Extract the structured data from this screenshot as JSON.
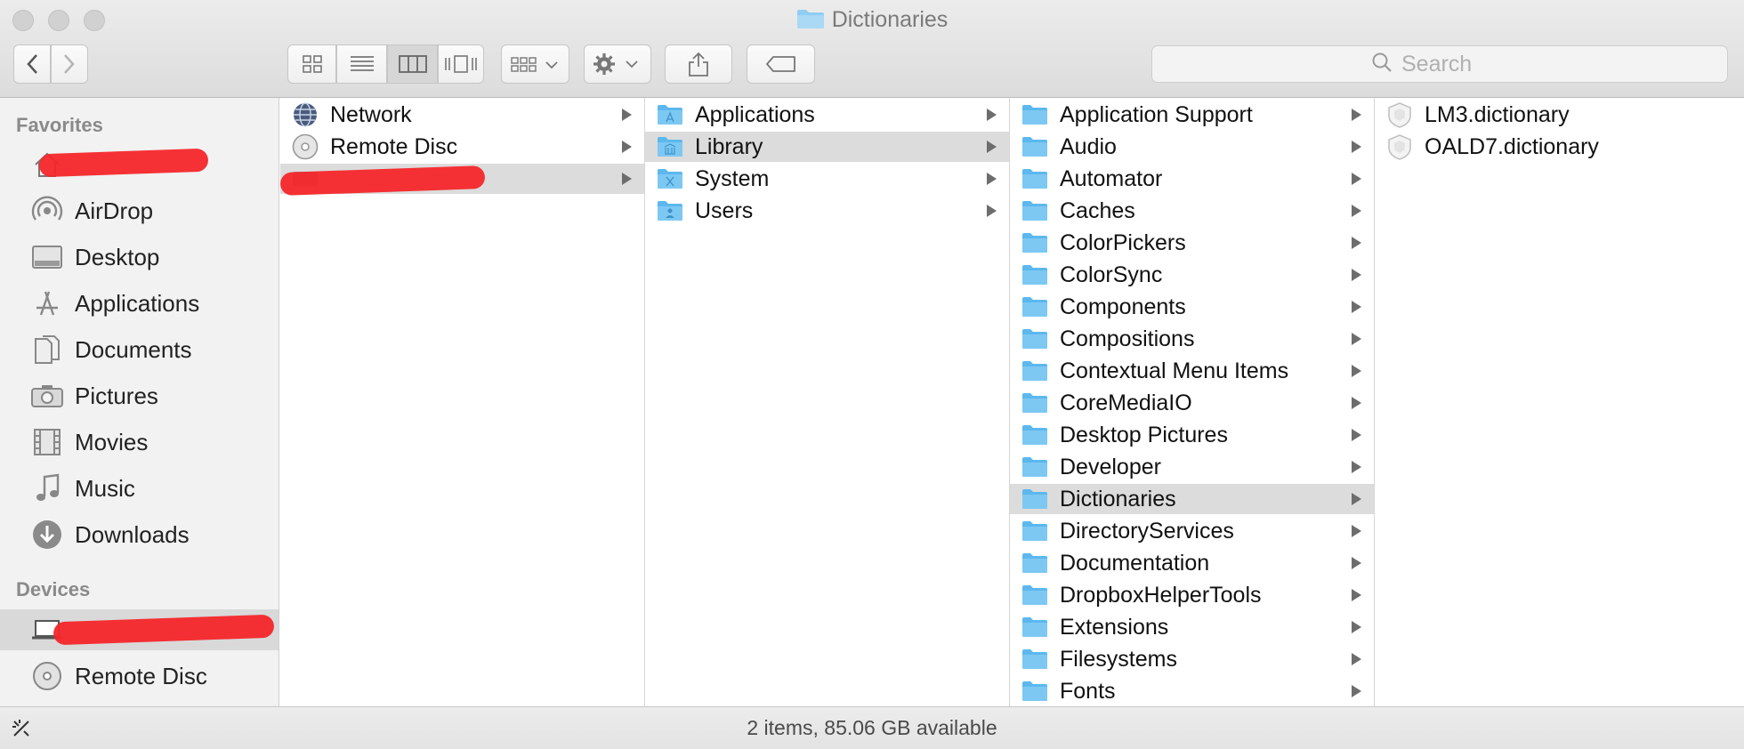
{
  "window": {
    "title": "Dictionaries"
  },
  "toolbar": {
    "back_icon": "chevron-left-icon",
    "forward_icon": "chevron-right-icon",
    "view_modes": [
      "icon-view",
      "list-view",
      "column-view",
      "cover-flow-view"
    ],
    "selected_view": "column-view",
    "search_placeholder": "Search"
  },
  "sidebar": {
    "favorites_header": "Favorites",
    "favorites": [
      {
        "label": "",
        "icon": "home-icon",
        "redacted": true
      },
      {
        "label": "AirDrop",
        "icon": "airdrop-icon"
      },
      {
        "label": "Desktop",
        "icon": "desktop-icon"
      },
      {
        "label": "Applications",
        "icon": "applications-icon"
      },
      {
        "label": "Documents",
        "icon": "documents-icon"
      },
      {
        "label": "Pictures",
        "icon": "camera-icon"
      },
      {
        "label": "Movies",
        "icon": "film-icon"
      },
      {
        "label": "Music",
        "icon": "music-note-icon"
      },
      {
        "label": "Downloads",
        "icon": "download-icon"
      }
    ],
    "devices_header": "Devices",
    "devices": [
      {
        "label": "",
        "icon": "laptop-icon",
        "redacted": true,
        "selected": true
      },
      {
        "label": "Remote Disc",
        "icon": "disc-icon"
      }
    ]
  },
  "columns": [
    {
      "items": [
        {
          "label": "Network",
          "icon": "globe-icon",
          "has_children": true
        },
        {
          "label": "Remote Disc",
          "icon": "disc-icon",
          "has_children": true
        },
        {
          "label": "",
          "icon": "drive-icon",
          "has_children": true,
          "redacted": true,
          "selected": true
        }
      ]
    },
    {
      "items": [
        {
          "label": "Applications",
          "icon": "folder-icon",
          "has_children": true
        },
        {
          "label": "Library",
          "icon": "folder-icon",
          "has_children": true,
          "selected": true
        },
        {
          "label": "System",
          "icon": "folder-icon",
          "has_children": true
        },
        {
          "label": "Users",
          "icon": "folder-icon",
          "has_children": true
        }
      ]
    },
    {
      "items": [
        {
          "label": "Application Support",
          "has_children": true
        },
        {
          "label": "Audio",
          "has_children": true
        },
        {
          "label": "Automator",
          "has_children": true
        },
        {
          "label": "Caches",
          "has_children": true
        },
        {
          "label": "ColorPickers",
          "has_children": true
        },
        {
          "label": "ColorSync",
          "has_children": true
        },
        {
          "label": "Components",
          "has_children": true
        },
        {
          "label": "Compositions",
          "has_children": true
        },
        {
          "label": "Contextual Menu Items",
          "has_children": true
        },
        {
          "label": "CoreMediaIO",
          "has_children": true
        },
        {
          "label": "Desktop Pictures",
          "has_children": true
        },
        {
          "label": "Developer",
          "has_children": true
        },
        {
          "label": "Dictionaries",
          "has_children": true,
          "selected": true
        },
        {
          "label": "DirectoryServices",
          "has_children": true
        },
        {
          "label": "Documentation",
          "has_children": true
        },
        {
          "label": "DropboxHelperTools",
          "has_children": true
        },
        {
          "label": "Extensions",
          "has_children": true
        },
        {
          "label": "Filesystems",
          "has_children": true
        },
        {
          "label": "Fonts",
          "has_children": true
        }
      ]
    },
    {
      "items": [
        {
          "label": "LM3.dictionary",
          "icon": "dictionary-file-icon"
        },
        {
          "label": "OALD7.dictionary",
          "icon": "dictionary-file-icon"
        }
      ]
    }
  ],
  "status": {
    "text": "2 items, 85.06 GB available"
  },
  "colors": {
    "folder": "#5cb8ee",
    "selection": "#dcdcdc",
    "redaction": "#f4262a"
  }
}
